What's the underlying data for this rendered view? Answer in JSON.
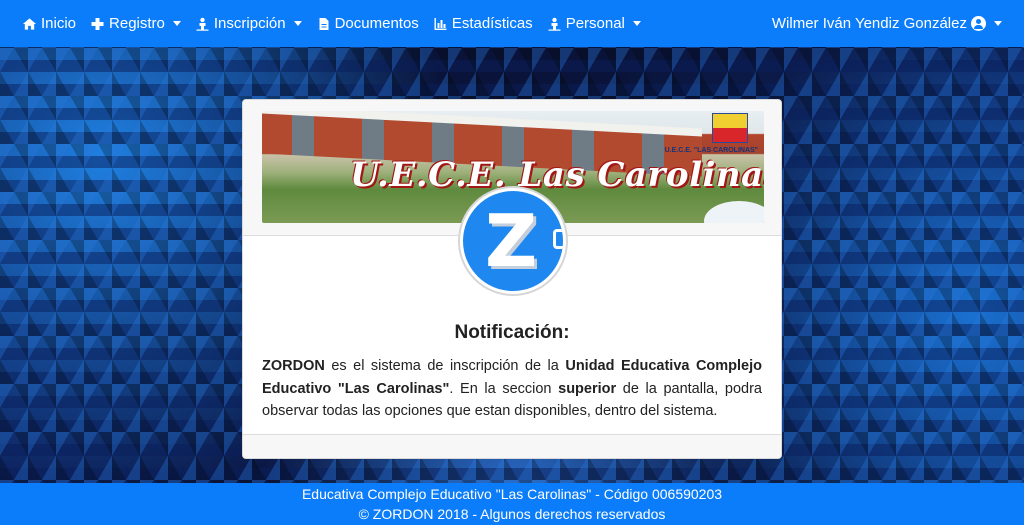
{
  "navbar": {
    "items": [
      {
        "label": "Inicio",
        "icon": "home-icon",
        "dropdown": false
      },
      {
        "label": "Registro",
        "icon": "plus-icon",
        "dropdown": true
      },
      {
        "label": "Inscripción",
        "icon": "person-icon",
        "dropdown": true
      },
      {
        "label": "Documentos",
        "icon": "file-icon",
        "dropdown": false
      },
      {
        "label": "Estadísticas",
        "icon": "bar-chart-icon",
        "dropdown": false
      },
      {
        "label": "Personal",
        "icon": "person-icon",
        "dropdown": true
      }
    ],
    "user": "Wilmer Iván Yendiz González"
  },
  "banner": {
    "title": "U.E.C.E. Las Carolinas",
    "crest_label": "U.E.C.E. \"LAS CAROLINAS\""
  },
  "logo": {
    "letter": "Z"
  },
  "notification": {
    "title": "Notificación:",
    "p1_bold": "ZORDON",
    "p2": " es el sistema de inscripción de la ",
    "p3_bold": "Unidad Educativa Complejo Educativo \"Las Carolinas\"",
    "p4": ". En la seccion ",
    "p5_bold": "superior",
    "p6": " de la pantalla, podra observar todas las opciones que estan disponibles, dentro del sistema."
  },
  "footer": {
    "line1": "Educativa Complejo Educativo \"Las Carolinas\" - Código 006590203",
    "line2": "© ZORDON 2018 - Algunos derechos reservados"
  },
  "colors": {
    "primary": "#0b7dfa",
    "logo_blue": "#1e88f0"
  }
}
